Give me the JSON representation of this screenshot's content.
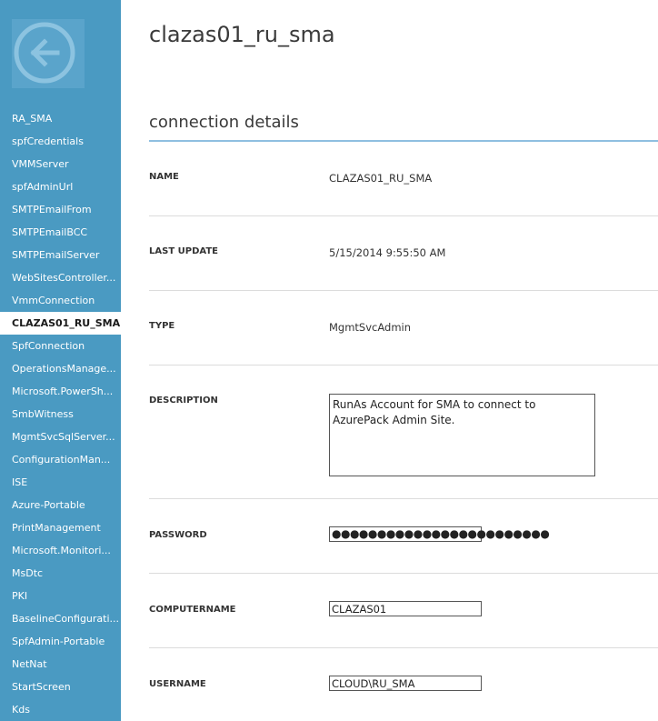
{
  "sidebar": {
    "items": [
      {
        "label": "RA_SMA",
        "active": false
      },
      {
        "label": "spfCredentials",
        "active": false
      },
      {
        "label": "VMMServer",
        "active": false
      },
      {
        "label": "spfAdminUrl",
        "active": false
      },
      {
        "label": "SMTPEmailFrom",
        "active": false
      },
      {
        "label": "SMTPEmailBCC",
        "active": false
      },
      {
        "label": "SMTPEmailServer",
        "active": false
      },
      {
        "label": "WebSitesController...",
        "active": false
      },
      {
        "label": "VmmConnection",
        "active": false
      },
      {
        "label": "CLAZAS01_RU_SMA",
        "active": true
      },
      {
        "label": "SpfConnection",
        "active": false
      },
      {
        "label": "OperationsManage...",
        "active": false
      },
      {
        "label": "Microsoft.PowerSh...",
        "active": false
      },
      {
        "label": "SmbWitness",
        "active": false
      },
      {
        "label": "MgmtSvcSqlServer...",
        "active": false
      },
      {
        "label": "ConfigurationMan...",
        "active": false
      },
      {
        "label": "ISE",
        "active": false
      },
      {
        "label": "Azure-Portable",
        "active": false
      },
      {
        "label": "PrintManagement",
        "active": false
      },
      {
        "label": "Microsoft.Monitori...",
        "active": false
      },
      {
        "label": "MsDtc",
        "active": false
      },
      {
        "label": "PKI",
        "active": false
      },
      {
        "label": "BaselineConfigurati...",
        "active": false
      },
      {
        "label": "SpfAdmin-Portable",
        "active": false
      },
      {
        "label": "NetNat",
        "active": false
      },
      {
        "label": "StartScreen",
        "active": false
      },
      {
        "label": "Kds",
        "active": false
      }
    ],
    "back_icon": "back-arrow-icon"
  },
  "main": {
    "title": "clazas01_ru_sma",
    "section_title": "connection details",
    "fields": {
      "name": {
        "label": "NAME",
        "value": "CLAZAS01_RU_SMA"
      },
      "last_update": {
        "label": "LAST UPDATE",
        "value": "5/15/2014 9:55:50 AM"
      },
      "type": {
        "label": "TYPE",
        "value": "MgmtSvcAdmin"
      },
      "description": {
        "label": "DESCRIPTION",
        "value": "RunAs Account for SMA to connect to AzurePack Admin Site."
      },
      "password": {
        "label": "PASSWORD",
        "value": "●●●●●●●●●●●●●●●●●●●●●●●●"
      },
      "computername": {
        "label": "COMPUTERNAME",
        "value": "CLAZAS01"
      },
      "username": {
        "label": "USERNAME",
        "value": "CLOUD\\RU_SMA"
      }
    }
  },
  "colors": {
    "sidebar_bg": "#4a9ac2",
    "accent_rule": "#8fbfe0",
    "active_item_bg": "#ffffff"
  }
}
